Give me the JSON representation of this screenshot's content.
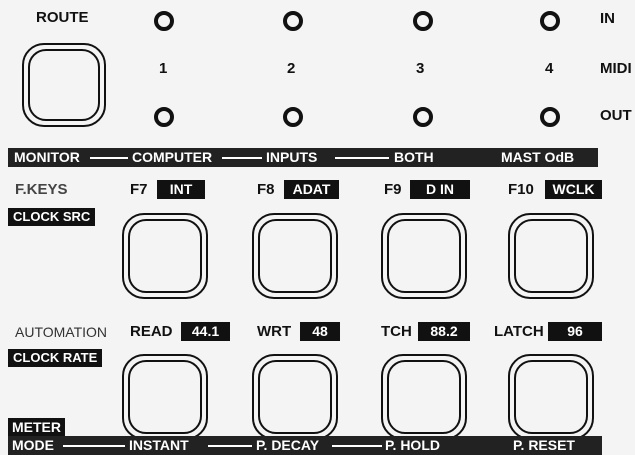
{
  "route": {
    "label": "ROUTE",
    "channels": [
      "1",
      "2",
      "3",
      "4"
    ],
    "side_labels": {
      "in": "IN",
      "midi": "MIDI",
      "out": "OUT"
    }
  },
  "monitor_bar": {
    "monitor": "MONITOR",
    "computer": "COMPUTER",
    "inputs": "INPUTS",
    "both": "BOTH",
    "mast": "MAST OdB"
  },
  "fkeys": {
    "label": "F.KEYS",
    "tag": "CLOCK SRC",
    "keys": [
      {
        "key": "F7",
        "value": "INT"
      },
      {
        "key": "F8",
        "value": "ADAT"
      },
      {
        "key": "F9",
        "value": "D IN"
      },
      {
        "key": "F10",
        "value": "WCLK"
      }
    ]
  },
  "automation": {
    "label": "AUTOMATION",
    "tag": "CLOCK RATE",
    "modes": [
      {
        "mode": "READ",
        "value": "44.1"
      },
      {
        "mode": "WRT",
        "value": "48"
      },
      {
        "mode": "TCH",
        "value": "88.2"
      },
      {
        "mode": "LATCH",
        "value": "96"
      }
    ]
  },
  "meter_bar": {
    "meter": "METER",
    "mode": "MODE",
    "instant": "INSTANT",
    "pdecay": "P. DECAY",
    "phold": "P. HOLD",
    "preset": "P. RESET"
  }
}
